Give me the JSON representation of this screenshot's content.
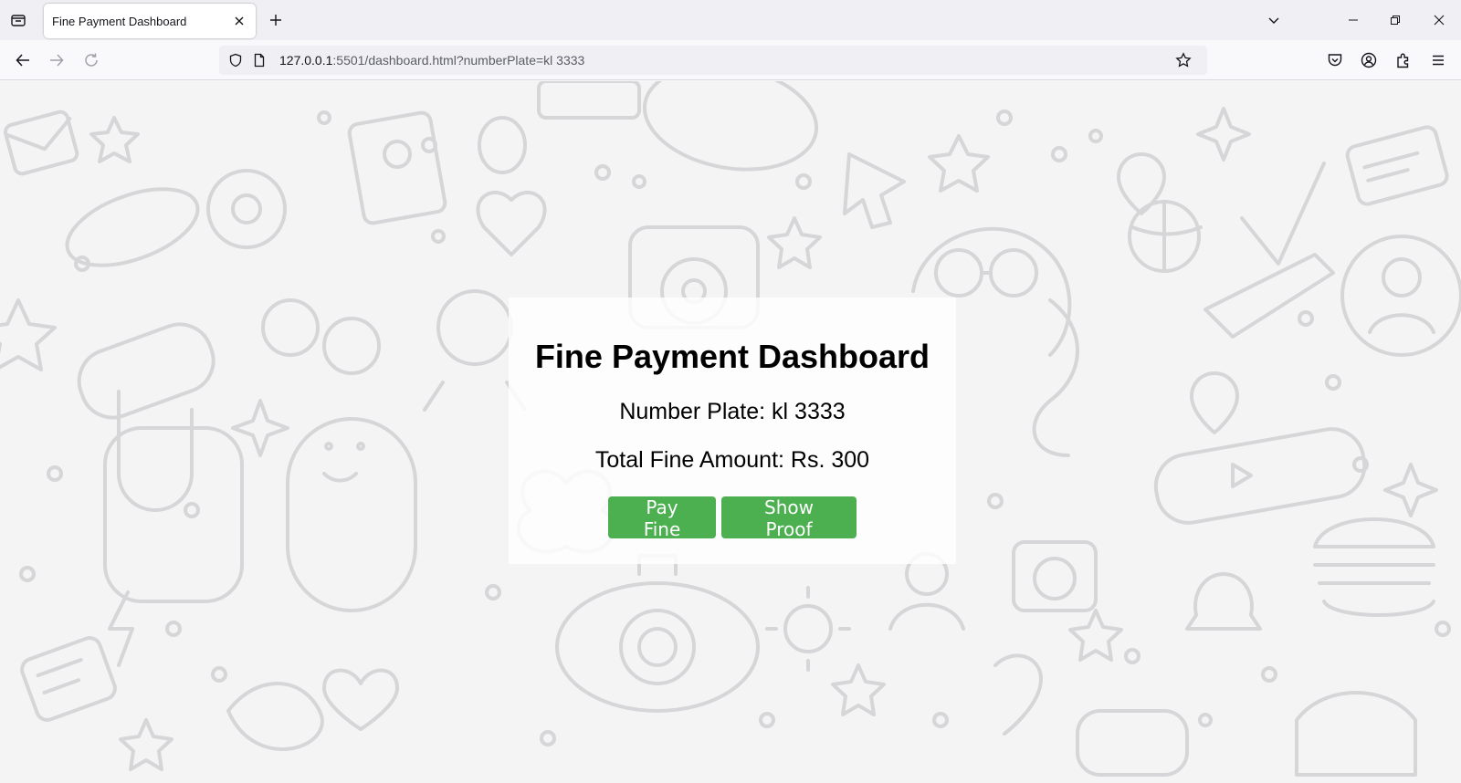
{
  "browser": {
    "tab_title": "Fine Payment Dashboard",
    "url_host": "127.0.0.1",
    "url_rest": ":5501/dashboard.html?numberPlate=kl 3333"
  },
  "page": {
    "title": "Fine Payment Dashboard",
    "number_plate_text": "Number Plate: kl 3333",
    "total_fine_text": "Total Fine Amount: Rs. 300",
    "pay_button_label": "Pay Fine",
    "proof_button_label": "Show Proof"
  },
  "colors": {
    "button_green": "#4caf50",
    "background": "#f4f4f5"
  },
  "icons": [
    "tab-list-icon",
    "close-icon",
    "plus-icon",
    "chevron-down-icon",
    "minimize-icon",
    "restore-icon",
    "window-close-icon",
    "back-arrow-icon",
    "forward-arrow-icon",
    "reload-icon",
    "shield-icon",
    "page-icon",
    "bookmark-star-icon",
    "pocket-icon",
    "account-icon",
    "extensions-icon",
    "menu-icon"
  ]
}
